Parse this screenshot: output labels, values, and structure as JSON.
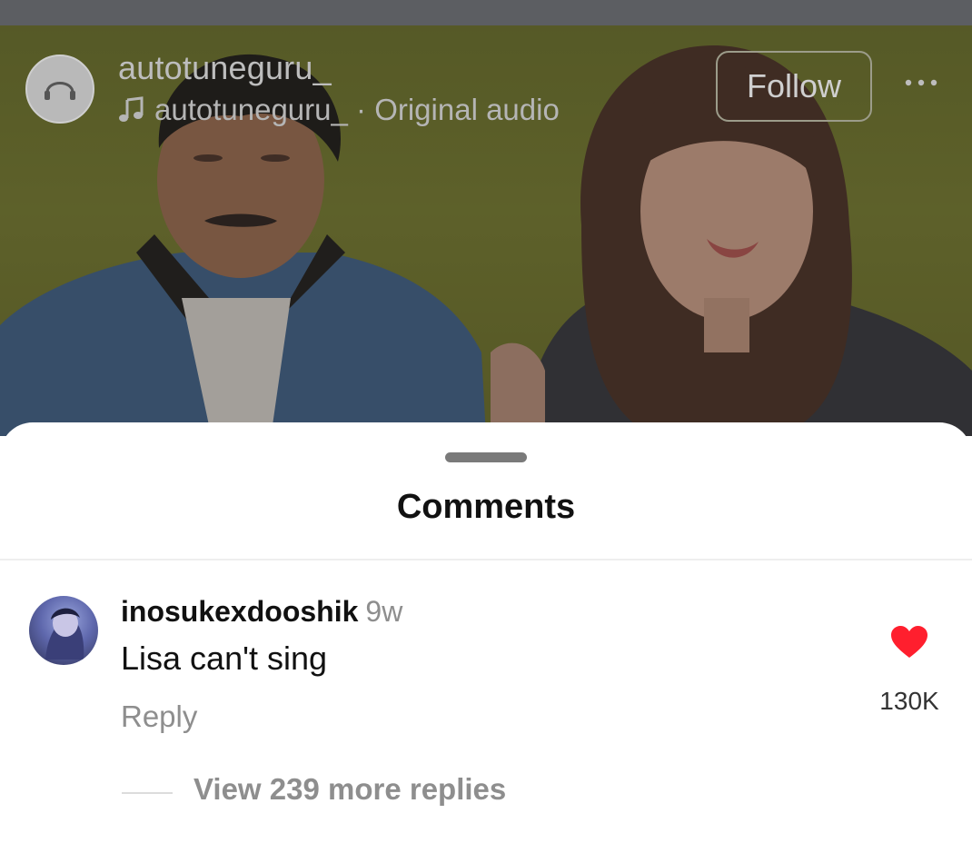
{
  "reel": {
    "username": "autotuneguru_",
    "audio_owner": "autotuneguru_",
    "audio_label": "· Original audio",
    "follow_label": "Follow",
    "more_label": "•••"
  },
  "comments_sheet": {
    "title": "Comments",
    "comments": [
      {
        "username": "inosukexdooshik",
        "time": "9w",
        "text": "Lisa can't sing",
        "reply_label": "Reply",
        "likes": "130K",
        "liked": true,
        "view_replies_label": "View 239 more replies"
      }
    ]
  },
  "colors": {
    "like_heart": "#ff1f2e",
    "video_background": "#6d7228",
    "secondary_text": "#8e8e8e"
  },
  "icons": {
    "audio": "music-note-icon",
    "like": "heart-icon",
    "more": "more-dots-icon"
  }
}
